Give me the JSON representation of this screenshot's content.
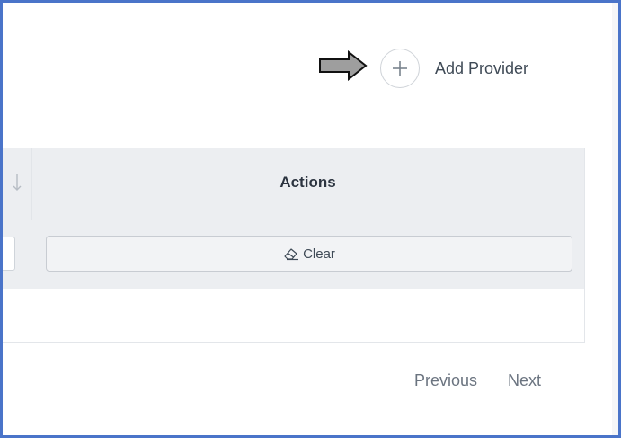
{
  "header": {
    "add_provider_label": "Add Provider",
    "add_icon": "plus-circle-icon",
    "pointer_icon": "right-arrow-icon"
  },
  "table": {
    "columns": [
      {
        "label": "",
        "icon": "sort-down-icon"
      },
      {
        "label": "Actions"
      }
    ],
    "filter_row": {
      "clear_label": "Clear",
      "clear_icon": "eraser-icon"
    }
  },
  "pagination": {
    "previous_label": "Previous",
    "next_label": "Next"
  },
  "colors": {
    "frame_border": "#4a74c9",
    "header_bg": "#eceef1",
    "text": "#3f4a56",
    "muted_text": "#6b7480"
  }
}
